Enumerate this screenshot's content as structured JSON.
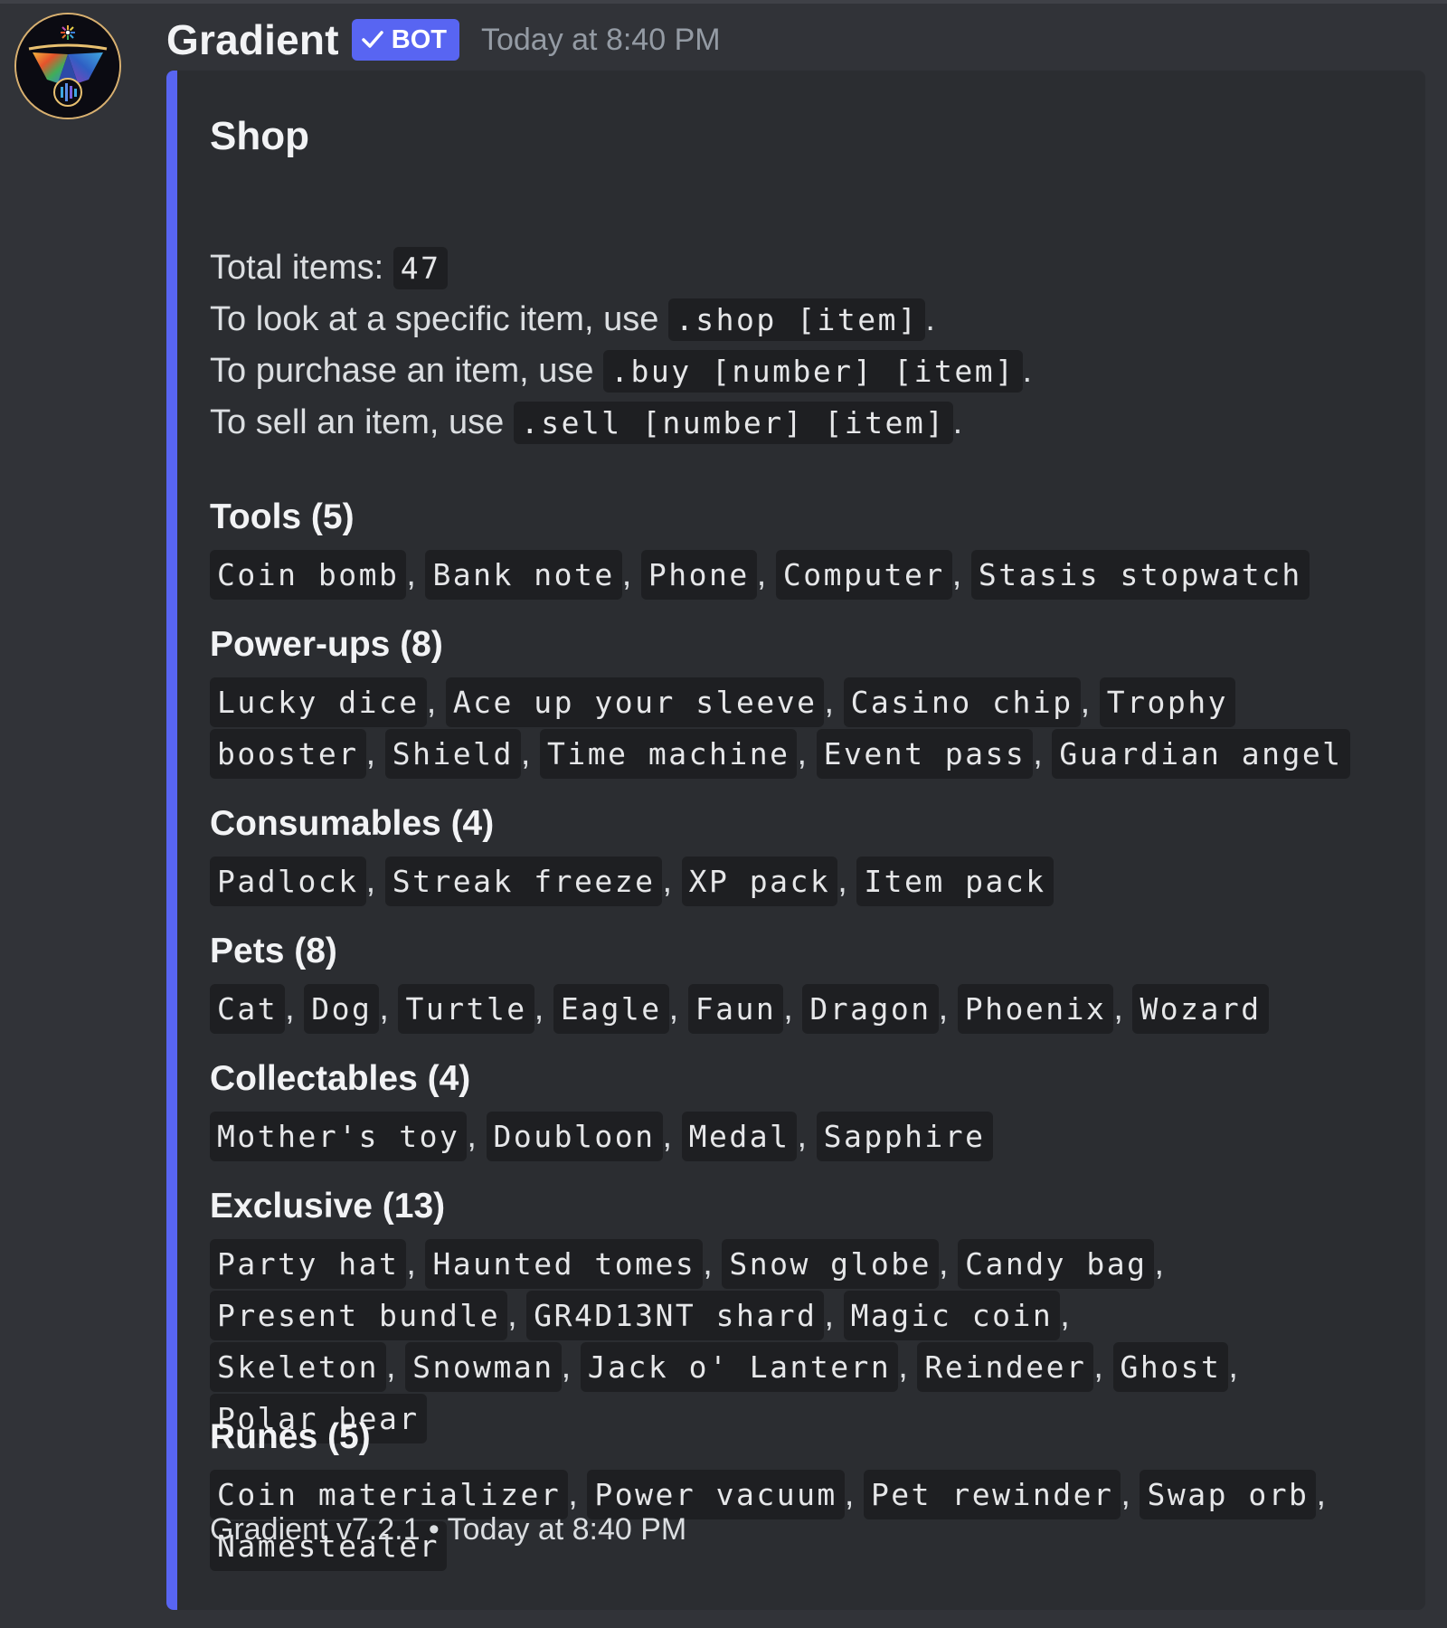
{
  "message": {
    "username": "Gradient",
    "bot_tag": "BOT",
    "timestamp": "Today at 8:40 PM",
    "avatar_icon": "gradient-logo-icon"
  },
  "embed": {
    "accent_color": "#5865f2",
    "title": "Shop",
    "description": {
      "total_label": "Total items: ",
      "total_value": "47",
      "look_text": "To look at a specific item, use ",
      "look_cmd": ".shop [item]",
      "buy_text": "To purchase an item, use ",
      "buy_cmd": ".buy [number] [item]",
      "sell_text": "To sell an item, use ",
      "sell_cmd": ".sell [number] [item]",
      "period": "."
    },
    "fields": [
      {
        "name": "Tools (5)",
        "items": [
          "Coin bomb",
          "Bank note",
          "Phone",
          "Computer",
          "Stasis stopwatch"
        ]
      },
      {
        "name": "Power-ups (8)",
        "items": [
          "Lucky dice",
          "Ace up your sleeve",
          "Casino chip",
          "Trophy booster",
          "Shield",
          "Time machine",
          "Event pass",
          "Guardian angel"
        ]
      },
      {
        "name": "Consumables (4)",
        "items": [
          "Padlock",
          "Streak freeze",
          "XP pack",
          "Item pack"
        ]
      },
      {
        "name": "Pets (8)",
        "items": [
          "Cat",
          "Dog",
          "Turtle",
          "Eagle",
          "Faun",
          "Dragon",
          "Phoenix",
          "Wozard"
        ]
      },
      {
        "name": "Collectables (4)",
        "items": [
          "Mother's toy",
          "Doubloon",
          "Medal",
          "Sapphire"
        ]
      },
      {
        "name": "Exclusive (13)",
        "items": [
          "Party hat",
          "Haunted tomes",
          "Snow globe",
          "Candy bag",
          "Present bundle",
          "GR4D13NT shard",
          "Magic coin",
          "Skeleton",
          "Snowman",
          "Jack o' Lantern",
          "Reindeer",
          "Ghost",
          "Polar bear"
        ]
      },
      {
        "name": "Runes (5)",
        "items": [
          "Coin materializer",
          "Power vacuum",
          "Pet rewinder",
          "Swap orb",
          "Namestealer"
        ]
      }
    ],
    "footer": "Gradient v7.2.1 • Today at 8:40 PM"
  }
}
